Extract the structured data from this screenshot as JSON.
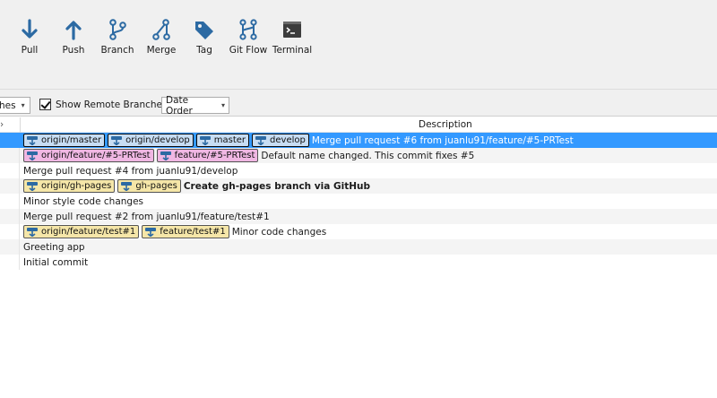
{
  "toolbar": {
    "buttons": [
      {
        "label": "Pull",
        "icon": "pull-icon"
      },
      {
        "label": "Push",
        "icon": "push-icon"
      },
      {
        "label": "Branch",
        "icon": "branch-icon"
      },
      {
        "label": "Merge",
        "icon": "merge-icon"
      },
      {
        "label": "Tag",
        "icon": "tag-icon"
      },
      {
        "label": "Git Flow",
        "icon": "git-flow-icon"
      },
      {
        "label": "Terminal",
        "icon": "terminal-icon"
      }
    ]
  },
  "filter": {
    "branches_combo": "hes",
    "show_remote_label": "Show Remote Branches",
    "show_remote_checked": true,
    "order_combo": "Date Order"
  },
  "table": {
    "header_left": "›",
    "description_header": "Description",
    "rows": [
      {
        "badges": [
          {
            "text": "origin/master",
            "kind": "remote"
          },
          {
            "text": "origin/develop",
            "kind": "remote"
          },
          {
            "text": "master",
            "kind": "local"
          },
          {
            "text": "develop",
            "kind": "local"
          }
        ],
        "message": "Merge pull request #6 from juanlu91/feature/#5-PRTest"
      },
      {
        "badges": [
          {
            "text": "origin/feature/#5-PRTest",
            "kind": "remote"
          },
          {
            "text": "feature/#5-PRTest",
            "kind": "local"
          }
        ],
        "message": "Default name changed. This commit fixes #5"
      },
      {
        "badges": [],
        "message": "Merge pull request #4 from juanlu91/develop"
      },
      {
        "badges": [
          {
            "text": "origin/gh-pages",
            "kind": "remote"
          },
          {
            "text": "gh-pages",
            "kind": "local"
          }
        ],
        "message": "Create gh-pages branch via GitHub"
      },
      {
        "badges": [],
        "message": "Minor style code changes"
      },
      {
        "badges": [],
        "message": "Merge pull request #2 from juanlu91/feature/test#1"
      },
      {
        "badges": [
          {
            "text": "origin/feature/test#1",
            "kind": "remote"
          },
          {
            "text": "feature/test#1",
            "kind": "local"
          }
        ],
        "message": "Minor code changes"
      },
      {
        "badges": [],
        "message": "Greeting app"
      },
      {
        "badges": [],
        "message": "Initial commit"
      }
    ]
  },
  "colors": {
    "selection": "#3399ff",
    "badge_blue": "#c7ddf3",
    "badge_pink": "#f0b7e3",
    "badge_yellow": "#f5e6a8",
    "icon_blue": "#2c6aa3"
  }
}
